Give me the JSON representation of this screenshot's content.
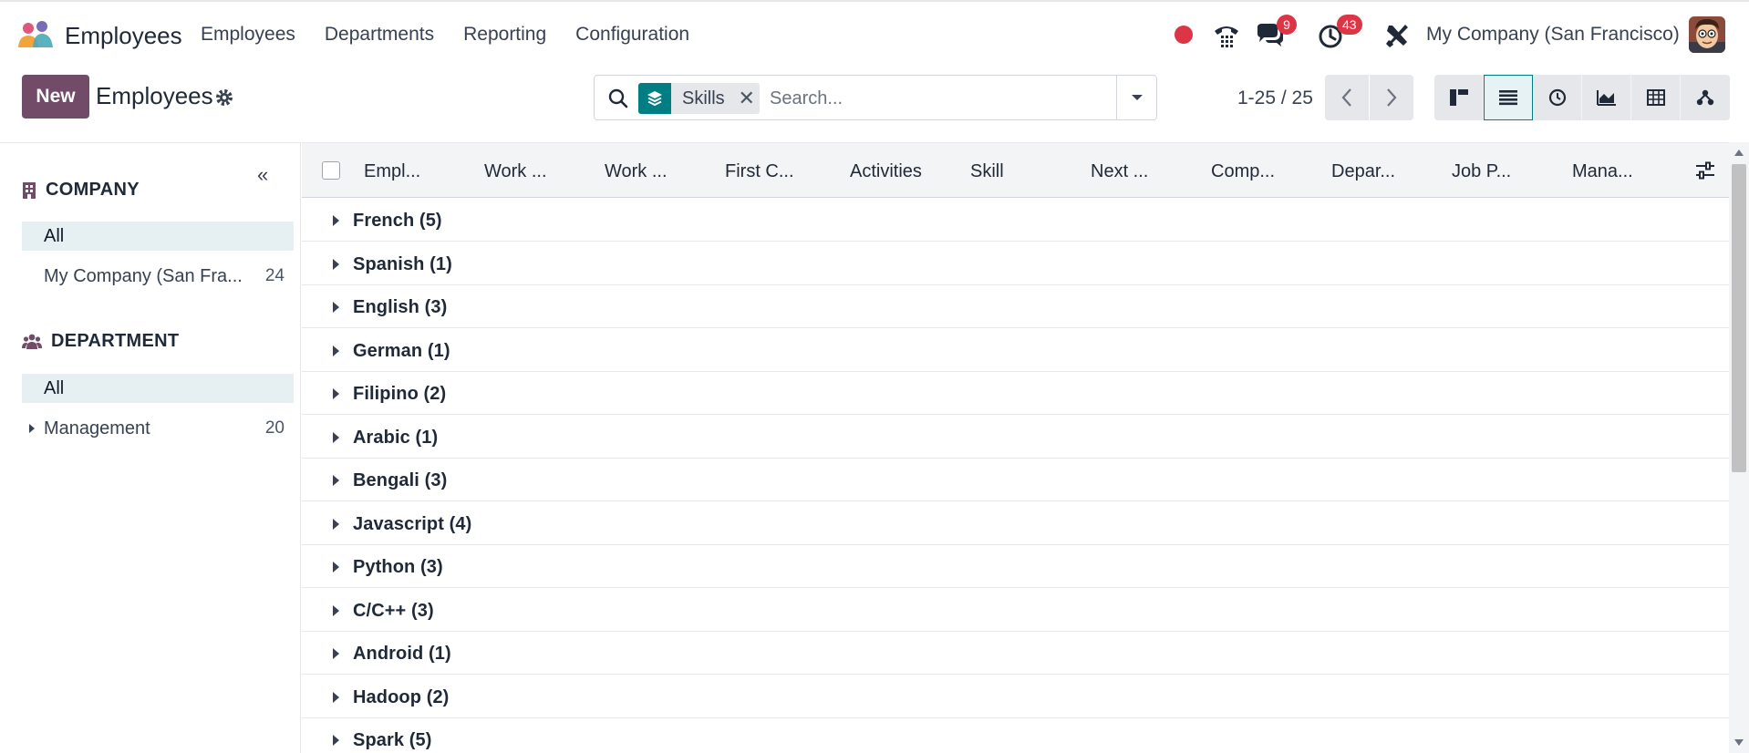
{
  "navbar": {
    "app_name": "Employees",
    "menu": [
      "Employees",
      "Departments",
      "Reporting",
      "Configuration"
    ],
    "messages_badge": "9",
    "activities_badge": "43",
    "company": "My Company (San Francisco)"
  },
  "control": {
    "new_label": "New",
    "title": "Employees",
    "search": {
      "facet_label": "Skills",
      "placeholder": "Search..."
    },
    "pager": "1-25 / 25"
  },
  "sidebar": {
    "company_title": "COMPANY",
    "company_items": [
      {
        "label": "All",
        "count": ""
      },
      {
        "label": "My Company (San Fra...",
        "count": "24"
      }
    ],
    "department_title": "DEPARTMENT",
    "department_items": [
      {
        "label": "All",
        "count": ""
      },
      {
        "label": "Management",
        "count": "20"
      }
    ]
  },
  "list": {
    "columns": [
      "Empl...",
      "Work ...",
      "Work ...",
      "First C...",
      "Activities",
      "Skill",
      "Next ...",
      "Comp...",
      "Depar...",
      "Job P...",
      "Mana..."
    ],
    "groups": [
      "French (5)",
      "Spanish (1)",
      "English (3)",
      "German (1)",
      "Filipino (2)",
      "Arabic (1)",
      "Bengali (3)",
      "Javascript (4)",
      "Python (3)",
      "C/C++ (3)",
      "Android (1)",
      "Hadoop (2)",
      "Spark (5)"
    ]
  },
  "colors": {
    "brand": "#714b67",
    "accent": "#017e84",
    "badge": "#dc3545"
  }
}
